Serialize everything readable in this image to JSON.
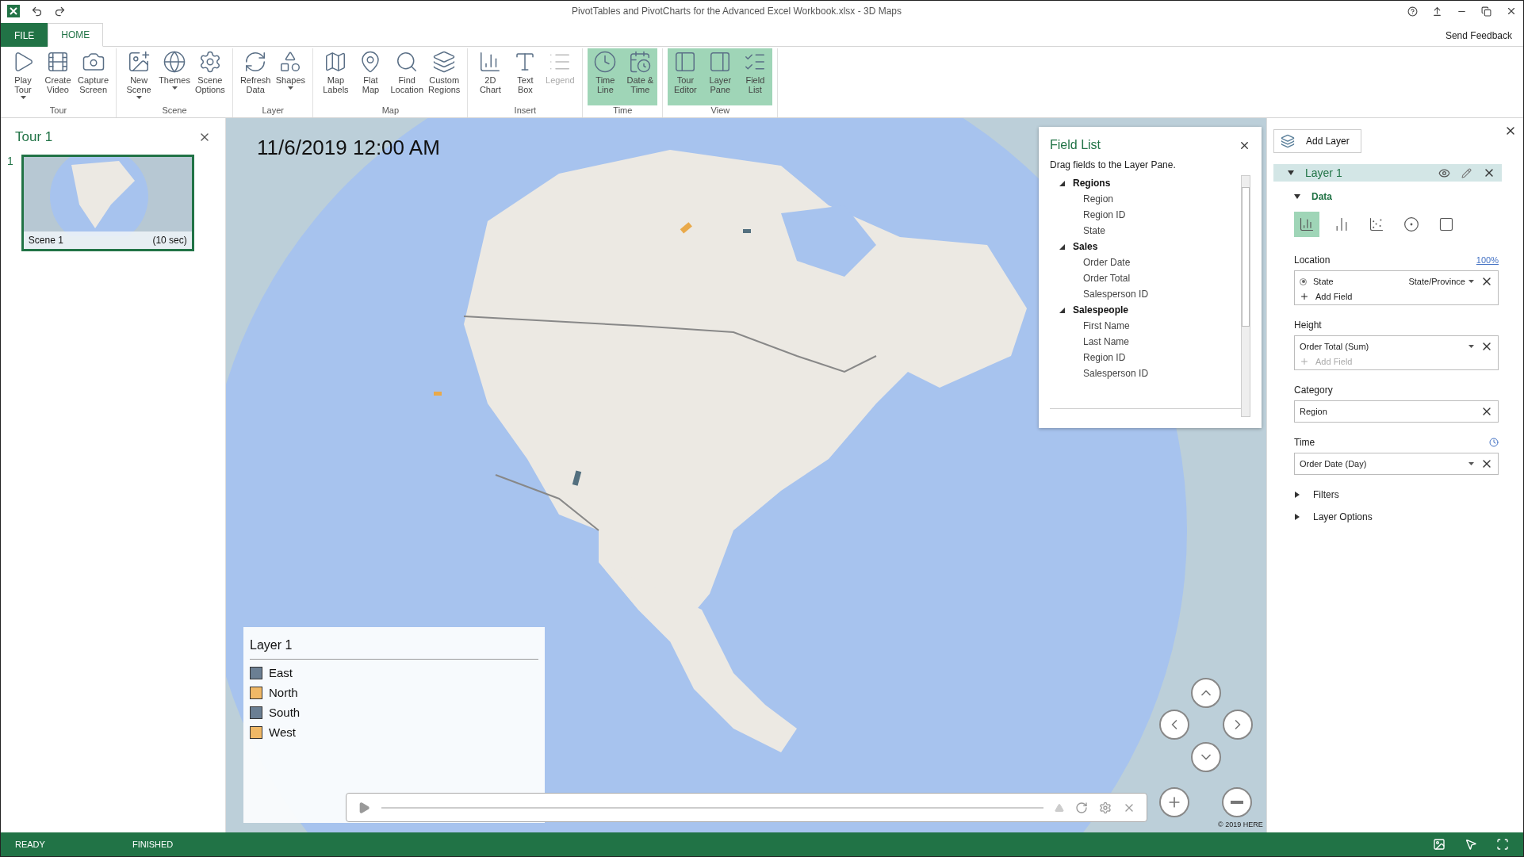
{
  "window": {
    "title": "PivotTables and PivotCharts for the Advanced Excel Workbook.xlsx - 3D Maps"
  },
  "menu_tabs": [
    {
      "label": "FILE",
      "kind": "file",
      "selected": false
    },
    {
      "label": "HOME",
      "kind": "tab",
      "selected": true
    }
  ],
  "send_feedback": "Send Feedback",
  "ribbon": [
    {
      "group": "Tour",
      "buttons": [
        {
          "label": "Play\nTour",
          "dropdown": true,
          "selected": false,
          "disabled": false
        },
        {
          "label": "Create\nVideo",
          "dropdown": false,
          "selected": false,
          "disabled": false
        },
        {
          "label": "Capture\nScreen",
          "dropdown": false,
          "selected": false,
          "disabled": false
        }
      ]
    },
    {
      "group": "Scene",
      "buttons": [
        {
          "label": "New\nScene",
          "dropdown": true,
          "selected": false,
          "disabled": false
        },
        {
          "label": "Themes",
          "dropdown": true,
          "selected": false,
          "disabled": false
        },
        {
          "label": "Scene\nOptions",
          "dropdown": false,
          "selected": false,
          "disabled": false
        }
      ]
    },
    {
      "group": "Layer",
      "buttons": [
        {
          "label": "Refresh\nData",
          "dropdown": false,
          "selected": false,
          "disabled": false
        },
        {
          "label": "Shapes",
          "dropdown": true,
          "selected": false,
          "disabled": false
        }
      ]
    },
    {
      "group": "Map",
      "buttons": [
        {
          "label": "Map\nLabels",
          "dropdown": false,
          "selected": false,
          "disabled": false
        },
        {
          "label": "Flat\nMap",
          "dropdown": false,
          "selected": false,
          "disabled": false
        },
        {
          "label": "Find\nLocation",
          "dropdown": false,
          "selected": false,
          "disabled": false
        },
        {
          "label": "Custom\nRegions",
          "dropdown": false,
          "selected": false,
          "disabled": false
        }
      ]
    },
    {
      "group": "Insert",
      "buttons": [
        {
          "label": "2D\nChart",
          "dropdown": false,
          "selected": false,
          "disabled": false
        },
        {
          "label": "Text\nBox",
          "dropdown": false,
          "selected": false,
          "disabled": false
        },
        {
          "label": "Legend",
          "dropdown": false,
          "selected": false,
          "disabled": true
        }
      ]
    },
    {
      "group": "Time",
      "buttons": [
        {
          "label": "Time\nLine",
          "dropdown": false,
          "selected": true,
          "disabled": false
        },
        {
          "label": "Date &\nTime",
          "dropdown": false,
          "selected": true,
          "disabled": false
        }
      ]
    },
    {
      "group": "View",
      "buttons": [
        {
          "label": "Tour\nEditor",
          "dropdown": false,
          "selected": true,
          "disabled": false
        },
        {
          "label": "Layer\nPane",
          "dropdown": false,
          "selected": true,
          "disabled": false
        },
        {
          "label": "Field\nList",
          "dropdown": false,
          "selected": true,
          "disabled": false
        }
      ]
    }
  ],
  "tour_pane": {
    "title": "Tour 1",
    "scenes": [
      {
        "number": "1",
        "name": "Scene 1",
        "duration": "(10 sec)",
        "selected": true
      }
    ]
  },
  "map": {
    "date": "11/6/2019 12:00 AM",
    "copyright": "© 2019 HERE"
  },
  "field_list": {
    "title": "Field List",
    "hint": "Drag fields to the Layer Pane.",
    "tables": [
      {
        "name": "Regions",
        "expanded": true,
        "fields": [
          "Region",
          "Region ID",
          "State"
        ]
      },
      {
        "name": "Sales",
        "expanded": true,
        "fields": [
          "Order Date",
          "Order Total",
          "Salesperson ID"
        ]
      },
      {
        "name": "Salespeople",
        "expanded": true,
        "fields": [
          "First Name",
          "Last Name",
          "Region ID",
          "Salesperson ID"
        ]
      }
    ]
  },
  "legend": {
    "title": "Layer 1",
    "items": [
      {
        "label": "East",
        "color": "#6b7f93"
      },
      {
        "label": "North",
        "color": "#f0b866"
      },
      {
        "label": "South",
        "color": "#6b7f93"
      },
      {
        "label": "West",
        "color": "#f0b866"
      }
    ]
  },
  "layer_pane": {
    "add_layer": "Add Layer",
    "layer": {
      "name": "Layer 1",
      "expanded": true
    },
    "data": {
      "title": "Data",
      "expanded": true
    },
    "viz_types": [
      {
        "selected": true
      },
      {
        "selected": false
      },
      {
        "selected": false
      },
      {
        "selected": false
      },
      {
        "selected": false
      }
    ],
    "location": {
      "label": "Location",
      "percent": "100%",
      "fields": [
        {
          "name": "State",
          "type": "State/Province"
        }
      ],
      "add_field": {
        "label": "Add Field",
        "disabled": false
      }
    },
    "height": {
      "label": "Height",
      "value": "Order Total (Sum)",
      "add_field": {
        "label": "Add Field",
        "disabled": true
      }
    },
    "category": {
      "label": "Category",
      "value": "Region"
    },
    "time": {
      "label": "Time",
      "value": "Order Date (Day)"
    },
    "sections": [
      {
        "label": "Filters",
        "expanded": false
      },
      {
        "label": "Layer Options",
        "expanded": false
      }
    ]
  },
  "status_bar": [
    "READY",
    "FINISHED"
  ]
}
